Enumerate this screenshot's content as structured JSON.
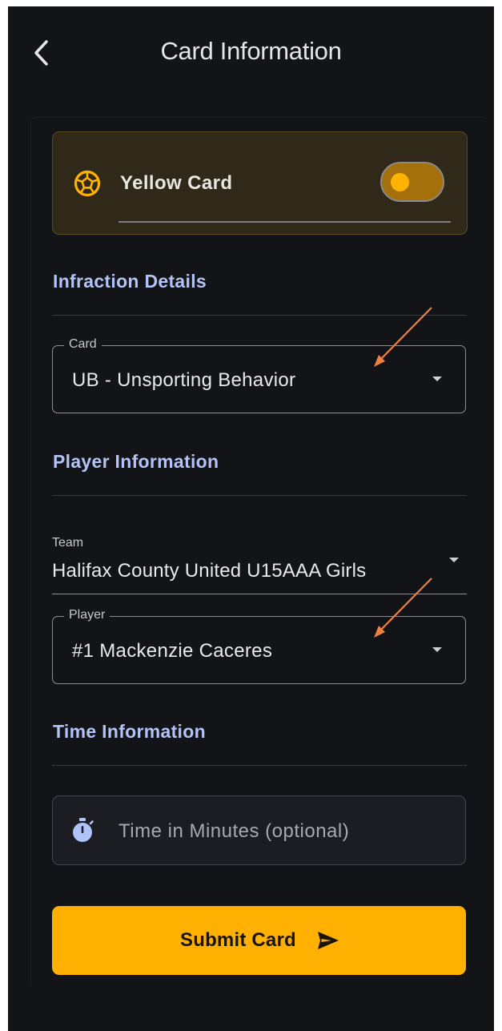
{
  "appbar": {
    "title": "Card Information",
    "back_icon": "chevron-left-icon"
  },
  "card_type": {
    "label": "Yellow Card",
    "icon": "soccer-ball-icon",
    "toggle_on": true,
    "accent": "#ffb300"
  },
  "sections": {
    "infraction": "Infraction Details",
    "player": "Player Information",
    "time": "Time Information"
  },
  "infraction": {
    "card_label": "Card",
    "card_value": "UB - Unsporting Behavior"
  },
  "player_info": {
    "team_label": "Team",
    "team_value": "Halifax County United U15AAA Girls",
    "player_label": "Player",
    "player_value": "#1 Mackenzie Caceres"
  },
  "time_info": {
    "placeholder": "Time in Minutes (optional)",
    "icon": "stopwatch-icon"
  },
  "submit": {
    "label": "Submit Card",
    "icon": "send-icon",
    "color": "#ffb000"
  },
  "annotations": {
    "arrow_color": "#f08040"
  }
}
